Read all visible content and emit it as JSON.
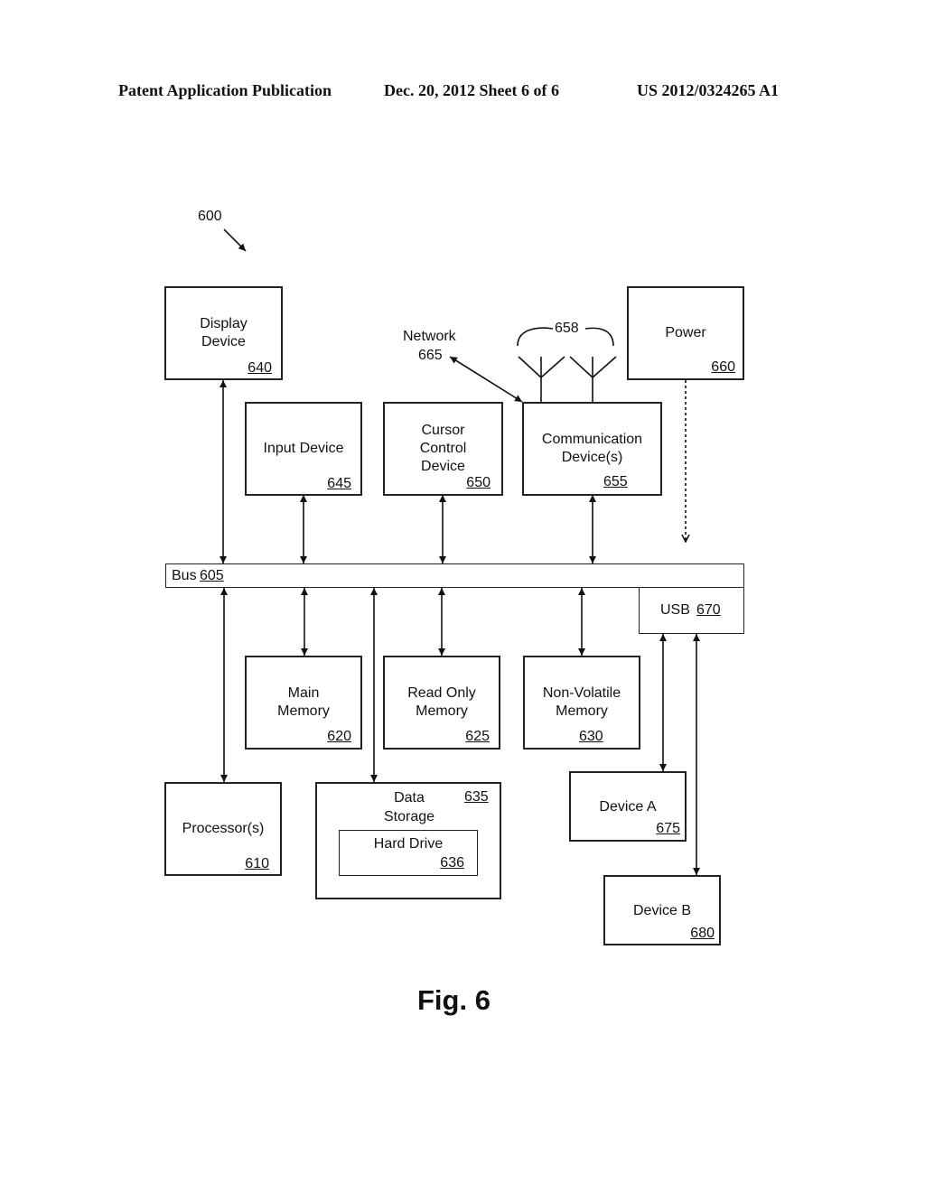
{
  "header": {
    "publication": "Patent Application Publication",
    "date_sheet": "Dec. 20, 2012   Sheet 6 of 6",
    "patent_number": "US 2012/0324265 A1"
  },
  "figure": {
    "ref": "600",
    "caption": "Fig. 6"
  },
  "blocks": {
    "display": {
      "line1": "Display",
      "line2": "Device",
      "ref": "640"
    },
    "input": {
      "line1": "Input Device",
      "ref": "645"
    },
    "cursor": {
      "line1": "Cursor",
      "line2": "Control",
      "line3": "Device",
      "ref": "650"
    },
    "comm": {
      "line1": "Communication",
      "line2": "Device(s)",
      "ref": "655"
    },
    "power": {
      "line1": "Power",
      "ref": "660"
    },
    "bus": {
      "label": "Bus",
      "ref": "605"
    },
    "usb": {
      "label": "USB",
      "ref": "670"
    },
    "main_memory": {
      "line1": "Main",
      "line2": "Memory",
      "ref": "620"
    },
    "rom": {
      "line1": "Read Only",
      "line2": "Memory",
      "ref": "625"
    },
    "nvm": {
      "line1": "Non-Volatile",
      "line2": "Memory",
      "ref": "630"
    },
    "processor": {
      "line1": "Processor(s)",
      "ref": "610"
    },
    "storage": {
      "line1": "Data",
      "line2": "Storage",
      "ref": "635"
    },
    "hard_drive": {
      "line1": "Hard Drive",
      "ref": "636"
    },
    "device_a": {
      "line1": "Device A",
      "ref": "675"
    },
    "device_b": {
      "line1": "Device B",
      "ref": "680"
    }
  },
  "annotations": {
    "network_label": "Network",
    "network_ref": "665",
    "antenna_ref": "658"
  }
}
